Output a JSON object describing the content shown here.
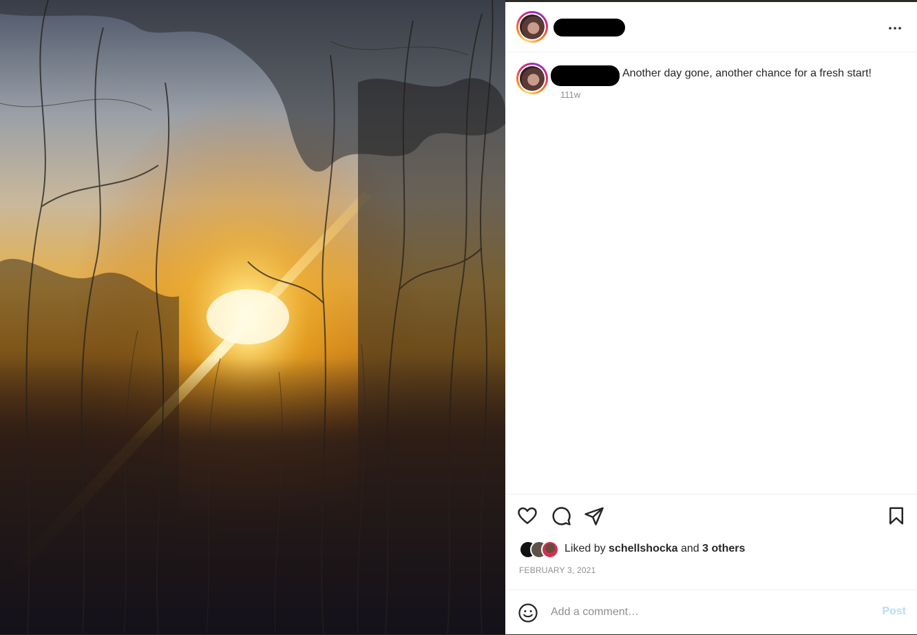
{
  "post": {
    "caption": "Another day gone, another chance for a fresh start!",
    "time_ago": "111w",
    "date": "FEBRUARY 3, 2021"
  },
  "likes": {
    "prefix": "Liked by ",
    "user": "schellshocka",
    "middle": " and ",
    "others": "3 others"
  },
  "comment": {
    "placeholder": "Add a comment…",
    "post_label": "Post"
  },
  "icons": {
    "more": "more-options-icon",
    "like": "heart-icon",
    "comment": "comment-icon",
    "share": "send-icon",
    "save": "bookmark-icon",
    "emoji": "smiley-icon"
  },
  "colors": {
    "post_button": "#b2dffc",
    "muted_text": "#8e8e8e",
    "text": "#262626"
  }
}
